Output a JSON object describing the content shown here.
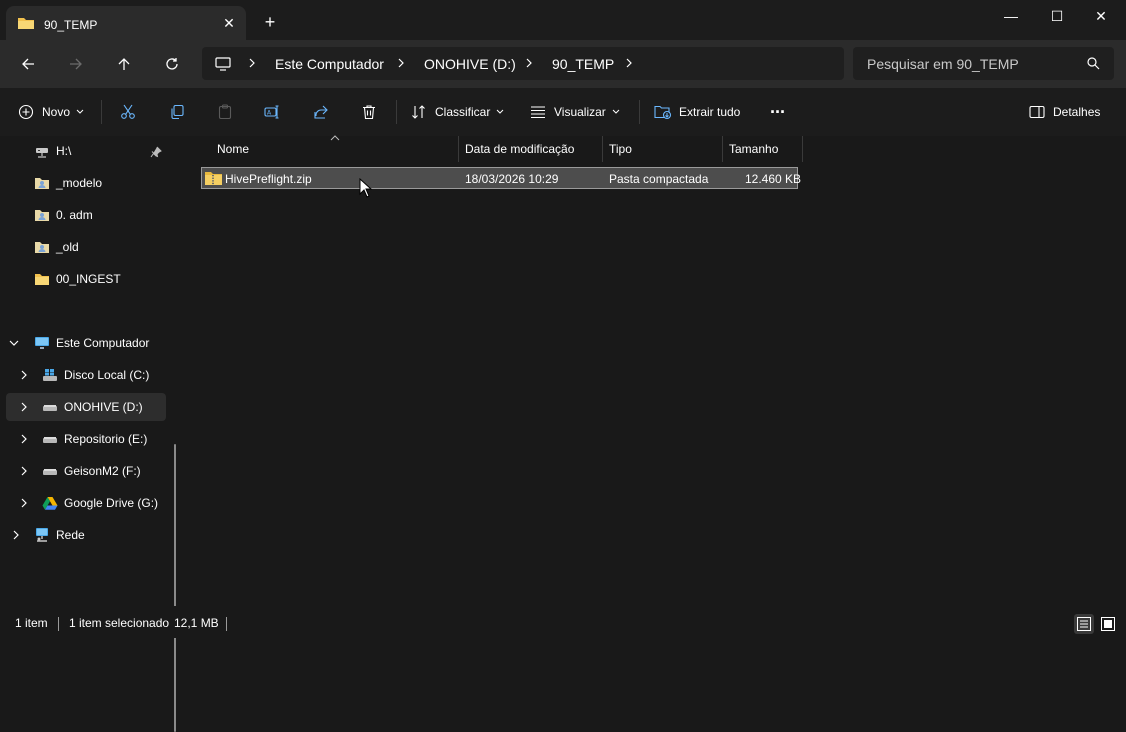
{
  "window": {
    "tab_title": "90_TEMP",
    "tab_close": "✕",
    "new_tab": "+",
    "minimize": "—",
    "maximize": "☐",
    "close": "✕"
  },
  "navbar": {
    "breadcrumbs": [
      "Este Computador",
      "ONOHIVE (D:)",
      "90_TEMP"
    ],
    "search_placeholder": "Pesquisar em 90_TEMP"
  },
  "toolbar": {
    "new_label": "Novo",
    "sort_label": "Classificar",
    "view_label": "Visualizar",
    "extract_label": "Extrair tudo",
    "more_label": "···",
    "details_label": "Detalhes"
  },
  "sidebar": {
    "quick_access": [
      {
        "label": "H:\\",
        "icon": "network-drive-icon",
        "pinned": true
      },
      {
        "label": "_modelo",
        "icon": "user-folder-icon"
      },
      {
        "label": "0. adm",
        "icon": "user-folder-icon"
      },
      {
        "label": "_old",
        "icon": "user-folder-icon"
      },
      {
        "label": "00_INGEST",
        "icon": "folder-icon"
      }
    ],
    "this_pc": {
      "label": "Este Computador",
      "icon": "computer-icon",
      "expanded": true
    },
    "drives": [
      {
        "label": "Disco Local (C:)",
        "icon": "windows-drive-icon"
      },
      {
        "label": "ONOHIVE (D:)",
        "icon": "drive-icon",
        "selected": true
      },
      {
        "label": "Repositorio (E:)",
        "icon": "drive-icon"
      },
      {
        "label": "GeisonM2 (F:)",
        "icon": "drive-icon"
      },
      {
        "label": "Google Drive (G:)",
        "icon": "google-drive-icon"
      }
    ],
    "network": {
      "label": "Rede",
      "icon": "network-icon"
    }
  },
  "file_list": {
    "columns": [
      "Nome",
      "Data de modificação",
      "Tipo",
      "Tamanho"
    ],
    "rows": [
      {
        "name": "HivePreflight.zip",
        "modified": "18/03/2026 10:29",
        "type": "Pasta compactada",
        "size": "12.460 KB",
        "selected": true
      }
    ]
  },
  "statusbar": {
    "item_count": "1 item",
    "selection": "1 item selecionado",
    "selection_size": "12,1 MB"
  },
  "colors": {
    "background": "#191919",
    "toolbar": "#2b2b2b",
    "selection": "#4d4d4d",
    "folder": "#f2c14e",
    "accent": "#4cc2ff"
  }
}
